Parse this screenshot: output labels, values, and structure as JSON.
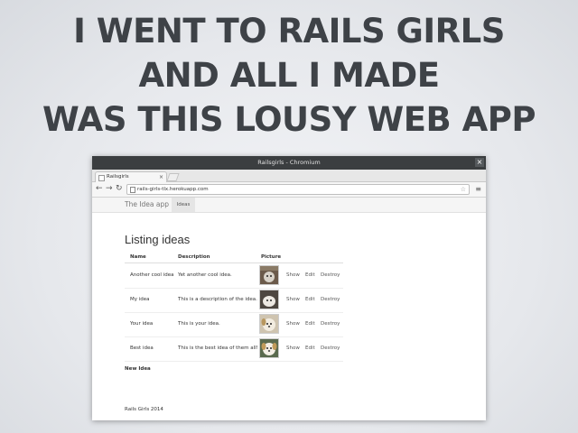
{
  "slide": {
    "title_lines": [
      "I WENT TO RAILS GIRLS",
      "AND ALL I MADE",
      "WAS THIS LOUSY WEB APP"
    ]
  },
  "browser": {
    "window_title": "Railsgirls - Chromium",
    "close_glyph": "×",
    "tab_label": "Railsgirls",
    "tab_close": "×",
    "url": "rails-girls-tlx.herokuapp.com",
    "back_glyph": "←",
    "forward_glyph": "→",
    "reload_glyph": "↻",
    "star_glyph": "☆",
    "menu_glyph": "≡"
  },
  "app": {
    "brand": "The Idea app",
    "nav_link": "Ideas",
    "heading": "Listing ideas",
    "columns": [
      "Name",
      "Description",
      "Picture"
    ],
    "rows": [
      {
        "name": "Another cool idea",
        "description": "Yet another cool idea.",
        "picture": "cat photo",
        "show": "Show",
        "edit": "Edit",
        "destroy": "Destroy"
      },
      {
        "name": "My idea",
        "description": "This is a description of the idea.",
        "picture": "cat photo",
        "show": "Show",
        "edit": "Edit",
        "destroy": "Destroy"
      },
      {
        "name": "Your idea",
        "description": "This is your idea.",
        "picture": "dog photo",
        "show": "Show",
        "edit": "Edit",
        "destroy": "Destroy"
      },
      {
        "name": "Best idea",
        "description": "This is the best idea of them all!",
        "picture": "dog photo",
        "show": "Show",
        "edit": "Edit",
        "destroy": "Destroy"
      }
    ],
    "new_link": "New Idea",
    "footer": "Rails Girls 2014"
  },
  "colors": {
    "title_text": "#3e4247",
    "titlebar": "#3b3e40",
    "nav_bg": "#f5f5f5"
  }
}
